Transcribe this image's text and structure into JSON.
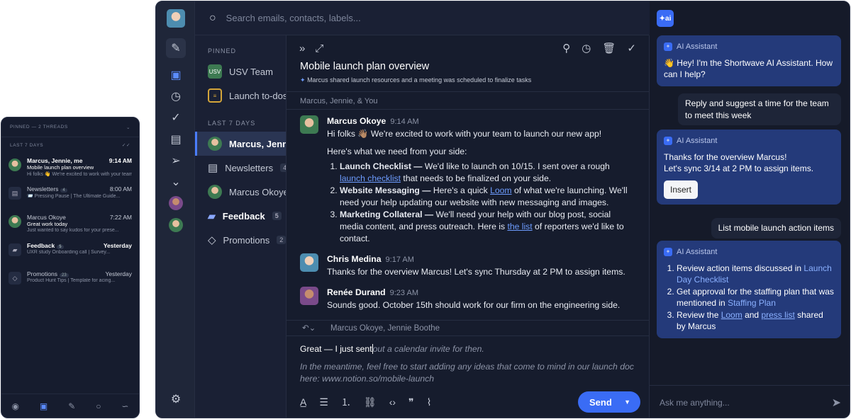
{
  "phone": {
    "pinned_header": "PINNED — 2 THREADS",
    "last7": "LAST 7 DAYS",
    "rows": [
      {
        "title": "Marcus, Jennie, me",
        "time": "9:14 AM",
        "subject": "Mobile launch plan overview",
        "preview": "Hi folks 👋 We're excited to work with your team...",
        "bold": true
      },
      {
        "title": "Newsletters",
        "count": "4",
        "time": "8:00 AM",
        "subject": "",
        "preview": "📨 Pressing Pause | The Ultimate Guide..."
      },
      {
        "title": "Marcus Okoye",
        "time": "7:22 AM",
        "subject": "Great work today",
        "preview": "Just wanted to say kudos for your prese..."
      },
      {
        "title": "Feedback",
        "count": "5",
        "time": "Yesterday",
        "subject": "",
        "preview": "UXR study  Onboarding call | Survey...",
        "bold": true
      },
      {
        "title": "Promotions",
        "count": "23",
        "time": "Yesterday",
        "subject": "",
        "preview": "Product Hunt Tips | Template for acing..."
      }
    ]
  },
  "search": {
    "placeholder": "Search emails, contacts, labels..."
  },
  "list": {
    "pinned": "PINNED",
    "last7": "LAST 7 DAYS",
    "pinned_items": [
      {
        "label": "USV Team",
        "abbr": "USV"
      },
      {
        "label": "Launch to-dos"
      }
    ],
    "items": [
      {
        "label": "Marcus, Jennie",
        "selected": true
      },
      {
        "label": "Newsletters",
        "badge": "4"
      },
      {
        "label": "Marcus Okoye"
      },
      {
        "label": "Feedback",
        "badge": "5",
        "bold": true
      },
      {
        "label": "Promotions",
        "badge": "2"
      }
    ]
  },
  "thread": {
    "title": "Mobile launch plan overview",
    "summary": "Marcus shared launch resources and a meeting was scheduled to finalize tasks",
    "participants": "Marcus, Jennie, & You",
    "m1": {
      "name": "Marcus Okoye",
      "time": "9:14 AM",
      "intro": "Hi folks 👋🏽 We're excited to work with your team to launch our new app!",
      "need": "Here's what we need from your side:",
      "i1b": "Launch Checklist —",
      "i1a": " We'd like to launch on 10/15. I sent over a rough ",
      "i1l": "launch checklist",
      "i1c": " that needs to be finalized on your side.",
      "i2b": "Website Messaging —",
      "i2a": " Here's a quick ",
      "i2l": "Loom",
      "i2c": " of what we're launching. We'll need your help updating our website with new messaging and images.",
      "i3b": "Marketing Collateral —",
      "i3a": " We'll need your help with our blog post, social media content, and press outreach. Here is ",
      "i3l": "the list",
      "i3c": " of reporters we'd like to contact."
    },
    "m2": {
      "name": "Chris Medina",
      "time": "9:17 AM",
      "text": "Thanks for the overview Marcus! Let's sync Thursday at 2 PM to assign items."
    },
    "m3": {
      "name": "Renée Durand",
      "time": "9:23 AM",
      "text": "Sounds good. October 15th should work for our firm on the engineering side."
    },
    "reply_to": "Marcus Okoye, Jennie Boothe",
    "draft": "Great — I just sent",
    "suggest": "out a calendar invite for then.",
    "suggest2": "In the meantime, feel free to start adding any ideas that come to mind in our launch doc here: www.notion.so/mobile-launch",
    "send": "Send"
  },
  "ai": {
    "logo": "✦ai",
    "label": "AI Assistant",
    "c1": "👋 Hey! I'm the Shortwave AI Assistant. How can I help?",
    "u1": "Reply and suggest a time for the team to meet this week",
    "c2": "Thanks for the overview Marcus!\nLet's sync 3/14 at 2 PM to assign items.",
    "insert": "Insert",
    "u2": "List mobile launch action items",
    "c3_1a": "Review action items discussed in",
    "c3_1l": "Launch Day Checklist",
    "c3_2a": "Get approval for the staffing plan that was mentioned in",
    "c3_2l": "Staffing Plan",
    "c3_3a": "Review the ",
    "c3_3l1": "Loom",
    "c3_3m": " and ",
    "c3_3l2": "press list",
    "c3_3c": " shared by Marcus",
    "placeholder": "Ask me anything..."
  }
}
